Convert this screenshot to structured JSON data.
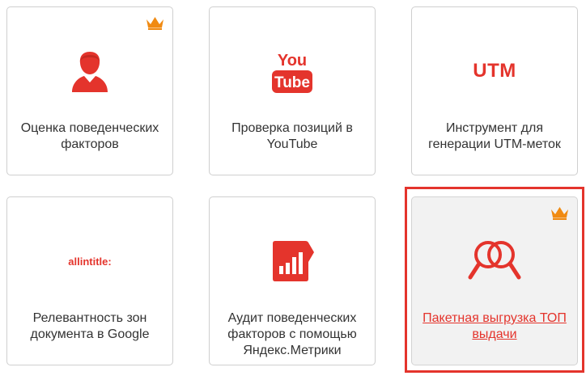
{
  "colors": {
    "accent": "#e4342c",
    "crown": "#f08a12",
    "border": "#cfcfcf",
    "text": "#333333",
    "active_bg": "#f2f2f2"
  },
  "tools": [
    {
      "label": "Оценка поведенческих факторов",
      "icon": "user-icon",
      "premium": true,
      "selected": false
    },
    {
      "label": "Проверка позиций в YouTube",
      "icon": "youtube-logo-icon",
      "icon_text_top": "You",
      "icon_text_bottom": "Tube",
      "premium": false,
      "selected": false
    },
    {
      "label": "Инструмент для генерации UTM-меток",
      "icon": "utm-text-icon",
      "icon_text": "UTM",
      "premium": false,
      "selected": false
    },
    {
      "label": "Релевантность зон документа в Google",
      "icon": "allintitle-text-icon",
      "icon_text": "allintitle:",
      "premium": false,
      "selected": false
    },
    {
      "label": "Аудит поведенческих факторов с помощью Яндекс.Метрики",
      "icon": "yandex-metrika-icon",
      "premium": false,
      "selected": false
    },
    {
      "label": "Пакетная выгрузка ТОП выдачи",
      "icon": "magnifier-pair-icon",
      "premium": true,
      "selected": true
    }
  ]
}
